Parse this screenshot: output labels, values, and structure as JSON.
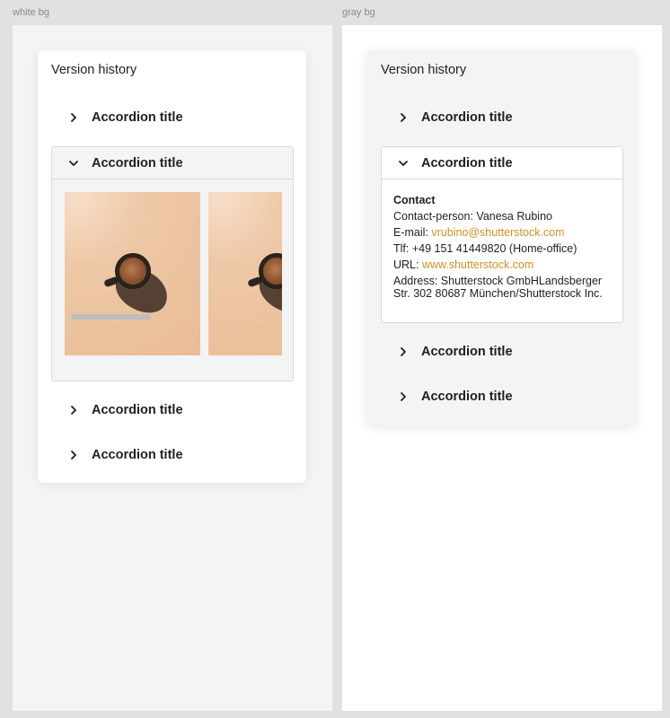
{
  "frames": {
    "left": {
      "label": "white bg"
    },
    "right": {
      "label": "gray bg"
    }
  },
  "panel_title": "Version history",
  "accordion_title": "Accordion title",
  "contact": {
    "heading": "Contact",
    "person_label": "Contact-person: ",
    "person_name": "Vanesa Rubino",
    "email_label": "E-mail: ",
    "email": "vrubino@shutterstock.com",
    "phone": "Tlf: +49 151 41449820 (Home-office)",
    "url_label": "URL: ",
    "url": "www.shutterstock.com",
    "address": "Address: Shutterstock GmbHLandsberger Str. 302 80687 München/Shutterstock Inc."
  },
  "colors": {
    "link": "#d1902a",
    "canvas": "#e1e1e1"
  },
  "icons": {
    "collapsed": "chevron-right-icon",
    "expanded": "chevron-down-icon"
  }
}
